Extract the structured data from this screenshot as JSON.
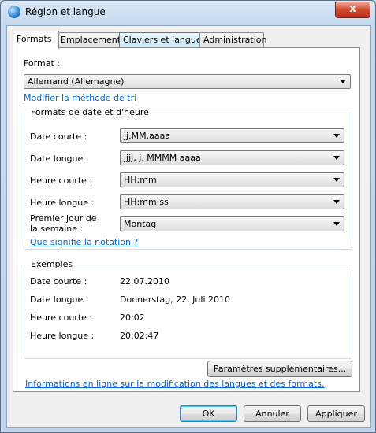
{
  "window": {
    "title": "Région et langue",
    "close_label": "x"
  },
  "tabs": [
    {
      "label": "Formats"
    },
    {
      "label": "Emplacement"
    },
    {
      "label": "Claviers et langues"
    },
    {
      "label": "Administration"
    }
  ],
  "format": {
    "label": "Format :",
    "selected": "Allemand (Allemagne)",
    "sort_link": "Modifier la méthode de tri"
  },
  "date_time_formats": {
    "group_title": "Formats de date et d'heure",
    "rows": [
      {
        "label": "Date courte :",
        "value": "jj.MM.aaaa"
      },
      {
        "label": "Date longue :",
        "value": "jjjj, j. MMMM aaaa"
      },
      {
        "label": "Heure courte :",
        "value": "HH:mm"
      },
      {
        "label": "Heure longue :",
        "value": "HH:mm:ss"
      }
    ],
    "first_day_label_line1": "Premier jour de",
    "first_day_label_line2": "la semaine :",
    "first_day_value": "Montag",
    "notation_link": "Que signifie la notation ?"
  },
  "examples": {
    "group_title": "Exemples",
    "rows": [
      {
        "label": "Date courte :",
        "value": "22.07.2010"
      },
      {
        "label": "Date longue :",
        "value": "Donnerstag, 22. Juli 2010"
      },
      {
        "label": "Heure courte :",
        "value": "20:02"
      },
      {
        "label": "Heure longue :",
        "value": "20:02:47"
      }
    ]
  },
  "additional_settings_button": "Paramètres supplémentaires...",
  "online_info_link": "Informations en ligne sur la modification des langues et des formats.",
  "footer": {
    "ok": "OK",
    "cancel": "Annuler",
    "apply": "Appliquer"
  }
}
